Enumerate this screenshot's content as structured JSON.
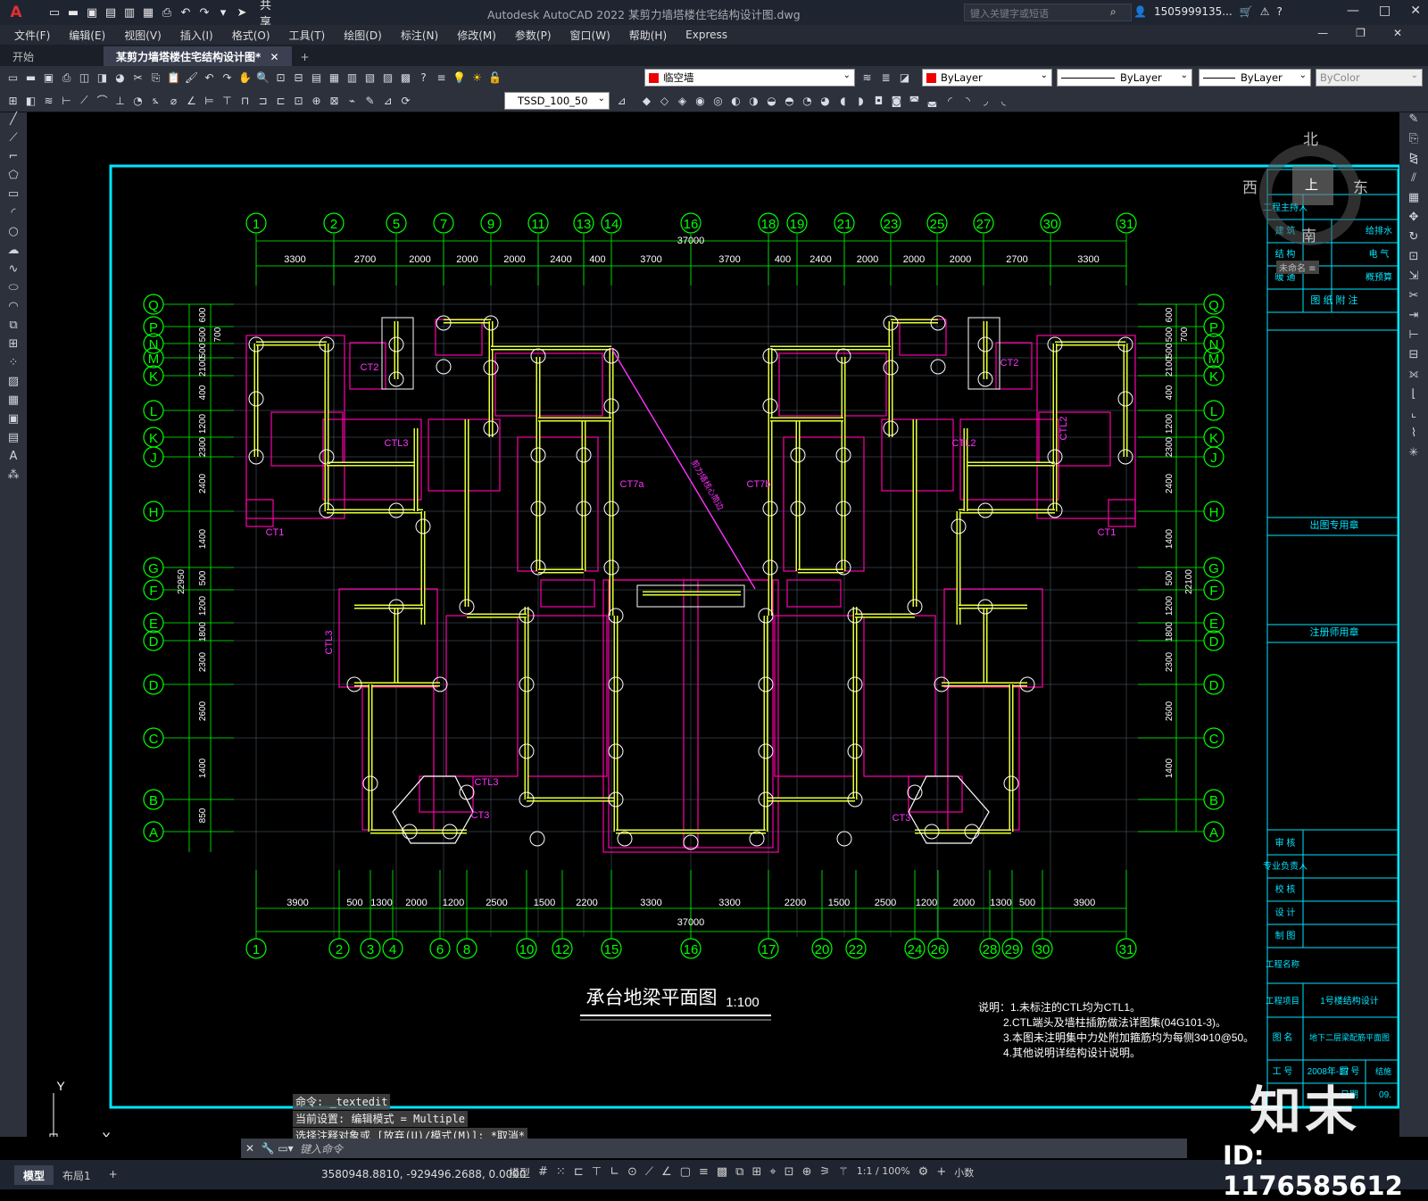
{
  "app": {
    "logo": "A",
    "title": "Autodesk AutoCAD 2022    某剪力墙塔楼住宅结构设计图.dwg",
    "share_label": "共享",
    "search_placeholder": "键入关键字或短语",
    "user": "1505999135...",
    "window_controls": [
      "—",
      "□",
      "✕"
    ]
  },
  "menu": {
    "items": [
      "文件(F)",
      "编辑(E)",
      "视图(V)",
      "插入(I)",
      "格式(O)",
      "工具(T)",
      "绘图(D)",
      "标注(N)",
      "修改(M)",
      "参数(P)",
      "窗口(W)",
      "帮助(H)",
      "Express"
    ]
  },
  "tabs": {
    "start": "开始",
    "doc": "某剪力墙塔楼住宅结构设计图*",
    "close": "✕",
    "add": "+"
  },
  "toolbar": {
    "layer": "临空墙",
    "color": "ByLayer",
    "linetype": "ByLayer",
    "lineweight": "ByLayer",
    "plotstyle": "ByColor",
    "textstyle": "TSSD_100_50"
  },
  "compass": {
    "n": "北",
    "s": "南",
    "e": "东",
    "w": "西",
    "center": "上",
    "wcs": "未命名 ≡"
  },
  "drawing": {
    "title": "承台地梁平面图",
    "scale": "1:100",
    "top_total": "37000",
    "bottom_total": "37000",
    "top_axes": [
      "1",
      "2",
      "5",
      "7",
      "9",
      "11",
      "13",
      "14",
      "16",
      "18",
      "19",
      "21",
      "23",
      "25",
      "27",
      "30",
      "31"
    ],
    "top_dims": [
      "3300",
      "2700",
      "2000",
      "2000",
      "2000",
      "2400",
      "400",
      "3700",
      "3700",
      "400",
      "2400",
      "2000",
      "2000",
      "2000",
      "2700",
      "3300"
    ],
    "bottom_axes": [
      "1",
      "2",
      "3",
      "4",
      "6",
      "8",
      "10",
      "12",
      "15",
      "16",
      "17",
      "20",
      "22",
      "24",
      "26",
      "28",
      "29",
      "30",
      "31"
    ],
    "bottom_dims": [
      "3900",
      "500",
      "1300",
      "2000",
      "1200",
      "2500",
      "1500",
      "2200",
      "3300",
      "3300",
      "2200",
      "1500",
      "2500",
      "1200",
      "2000",
      "1300",
      "500",
      "3900"
    ],
    "row_axes": [
      "Q",
      "P",
      "N",
      "M",
      "K",
      "L",
      "K",
      "J",
      "H",
      "G",
      "F",
      "E",
      "D",
      "D",
      "C",
      "B",
      "A"
    ],
    "left_dims": [
      "600",
      "500",
      "500",
      "2100",
      "400",
      "1200",
      "2300",
      "2400",
      "1400",
      "500",
      "1200",
      "1800",
      "2300",
      "2600",
      "1400",
      "850"
    ],
    "right_dims": [
      "600",
      "500",
      "500",
      "2100",
      "400",
      "1200",
      "2300",
      "2400",
      "1400",
      "500",
      "1200",
      "1800",
      "2300",
      "2600",
      "1400"
    ],
    "left_total": "22950",
    "right_total": "22100",
    "small_700": "700",
    "beam_labels": [
      "CT2",
      "CTL3",
      "CT1",
      "CT7a",
      "CT7b",
      "CTL2",
      "CT2",
      "CTL2",
      "CT1",
      "CTL3",
      "CTL3",
      "CT3",
      "CT3"
    ],
    "diag_label": "剪力墙核心筒边",
    "notes": [
      "说明：1.未标注的CTL均为CTL1。",
      "2.CTL端头及墙柱插筋做法详图集(04G101-3)。",
      "3.本图未注明集中力处附加箍筋均为每侧3Φ10@50。",
      "4.其他说明详结构设计说明。"
    ],
    "ucs_y": "Y",
    "ucs_x": "X"
  },
  "titleblock": {
    "rows_top": [
      "工程主持人",
      "建 筑",
      "结 构",
      "暖 通"
    ],
    "rows_top_right": [
      "",
      "给排水",
      "电 气",
      "概预算"
    ],
    "note_head": "图 纸 附 注",
    "sec2": "出图专用章",
    "sec3": "注册师用章",
    "sign_rows": [
      "审 核",
      "专业负责人",
      "校 核",
      "设 计",
      "制 图"
    ],
    "project_name_label": "工程名称",
    "project_item_label": "工程项目",
    "project_item": "1号楼结构设计",
    "drawing_name_label": "图 名",
    "drawing_name": "地下二层梁配筋平面图",
    "job_label": "工 号",
    "job_no": "2008年-17",
    "sheet_label": "图 号",
    "sheet_no": "结施",
    "date_label": "日期",
    "date": "09."
  },
  "command": {
    "hist1": "命令: _textedit",
    "hist2": "当前设置: 编辑模式 = Multiple",
    "hist3": "选择注释对象或 [放弃(U)/模式(M)]: *取消*",
    "placeholder": "键入命令"
  },
  "status": {
    "model_tab": "模型",
    "layout_tab": "布局1",
    "add": "+",
    "coords": "3580948.8810, -929496.2688, 0.0000",
    "model": "模型",
    "scale": "1:1 / 100%",
    "units": "小数"
  },
  "watermark": {
    "brand": "知末",
    "id": "ID: 1176585612"
  },
  "colors": {
    "frame": "#00e5ff",
    "axis": "#00ff00",
    "wall": "#e6ff33",
    "beam": "#ff00aa",
    "label": "#ff33ff",
    "bg": "#000000"
  }
}
